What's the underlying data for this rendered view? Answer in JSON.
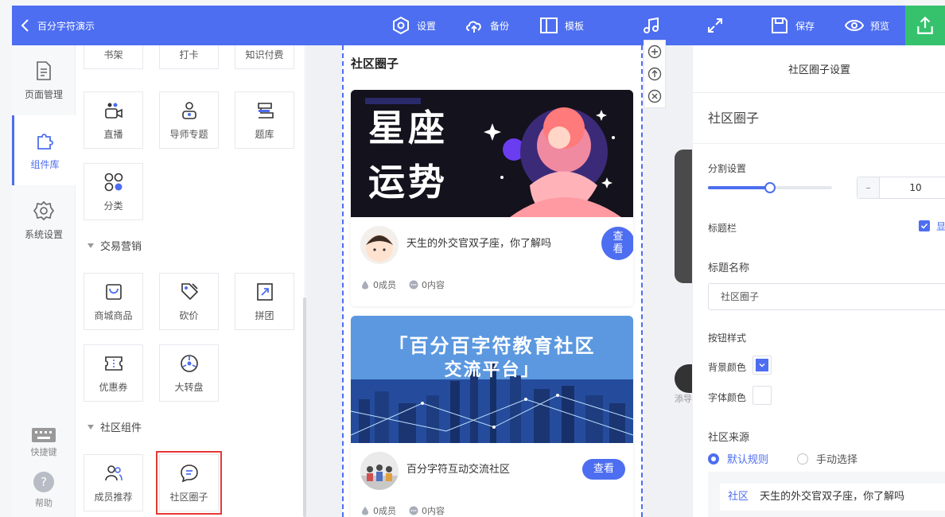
{
  "app": {
    "title": "百分字符演示"
  },
  "toolbar": {
    "settings": "设置",
    "backup": "备份",
    "template": "模板",
    "save": "保存",
    "preview": "预览"
  },
  "left_nav": {
    "page_manage": "页面管理",
    "component_lib": "组件库",
    "system_settings": "系统设置",
    "shortcuts": "快捷键",
    "help": "帮助"
  },
  "components": {
    "row0": [
      "书架",
      "打卡",
      "知识付费"
    ],
    "row1": [
      "直播",
      "导师专题",
      "题库"
    ],
    "row2": [
      "分类"
    ],
    "section_trade": "交易营销",
    "row3": [
      "商城商品",
      "砍价",
      "拼团"
    ],
    "row4": [
      "优惠券",
      "大转盘"
    ],
    "section_community": "社区组件",
    "row5": [
      "成员推荐",
      "社区圈子"
    ]
  },
  "preview": {
    "section_title": "社区圈子",
    "cards": [
      {
        "banner_line1": "星座",
        "banner_line2": "运势",
        "text": "天生的外交官双子座，你了解吗",
        "button": "查看",
        "button_line1": "查",
        "button_line2": "看",
        "members": "0成员",
        "contents": "0内容"
      },
      {
        "banner_title": "「百分百字符教育社区",
        "banner_sub": "交流平台」",
        "text": "百分字符互动交流社区",
        "button": "查看",
        "members": "0成员",
        "contents": "0内容"
      }
    ],
    "add_guide": "添导"
  },
  "settings": {
    "header": "社区圈子设置",
    "sub_title": "社区圈子",
    "divider_label": "分割设置",
    "divider_value": 10,
    "divider_display": "10",
    "title_bar_label": "标题栏",
    "title_bar_check": "显",
    "title_name_label": "标题名称",
    "title_name_value": "社区圈子",
    "button_style_label": "按钮样式",
    "bg_color_label": "背景颜色",
    "font_color_label": "字体颜色",
    "bg_color": "#4d6ef0",
    "font_color": "#ffffff",
    "source_label": "社区来源",
    "source_default": "默认规则",
    "source_manual": "手动选择",
    "source_tag": "社区",
    "source_item": "天生的外交官双子座，你了解吗"
  },
  "colors": {
    "accent": "#4d6ef0",
    "publish": "#36c26d",
    "highlight": "#e53935"
  }
}
